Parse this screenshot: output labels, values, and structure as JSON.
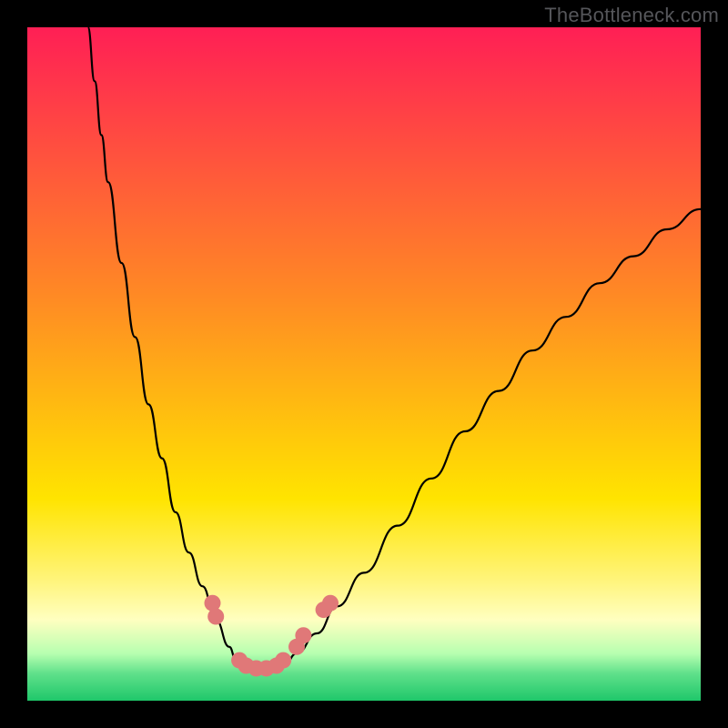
{
  "watermark": "TheBottleneck.com",
  "chart_data": {
    "type": "line",
    "title": "",
    "xlabel": "",
    "ylabel": "",
    "xlim": [
      0,
      100
    ],
    "ylim": [
      0,
      100
    ],
    "grid": false,
    "legend": false,
    "gradient_stops": [
      {
        "offset": 0.0,
        "color": "#ff1f55"
      },
      {
        "offset": 0.4,
        "color": "#ff8a24"
      },
      {
        "offset": 0.7,
        "color": "#ffe400"
      },
      {
        "offset": 0.82,
        "color": "#fff47a"
      },
      {
        "offset": 0.88,
        "color": "#ffffc0"
      },
      {
        "offset": 0.93,
        "color": "#b7ffb0"
      },
      {
        "offset": 0.96,
        "color": "#5fe08a"
      },
      {
        "offset": 1.0,
        "color": "#1fc76a"
      }
    ],
    "series": [
      {
        "name": "left-branch",
        "color": "#000000",
        "x": [
          9,
          10,
          11,
          12,
          14,
          16,
          18,
          20,
          22,
          24,
          26,
          28,
          30,
          31,
          32
        ],
        "values": [
          100,
          92,
          84,
          77,
          65,
          54,
          44,
          36,
          28,
          22,
          17,
          12,
          8,
          6,
          5
        ]
      },
      {
        "name": "right-branch",
        "color": "#000000",
        "x": [
          38,
          40,
          43,
          46,
          50,
          55,
          60,
          65,
          70,
          75,
          80,
          85,
          90,
          95,
          100
        ],
        "values": [
          5,
          7,
          10,
          14,
          19,
          26,
          33,
          40,
          46,
          52,
          57,
          62,
          66,
          70,
          73
        ]
      }
    ],
    "marker_points": [
      {
        "x": 27.5,
        "y": 14.5
      },
      {
        "x": 28.0,
        "y": 12.5
      },
      {
        "x": 31.5,
        "y": 6.0
      },
      {
        "x": 32.5,
        "y": 5.2
      },
      {
        "x": 34.0,
        "y": 4.8
      },
      {
        "x": 35.5,
        "y": 4.8
      },
      {
        "x": 37.0,
        "y": 5.2
      },
      {
        "x": 38.0,
        "y": 6.0
      },
      {
        "x": 40.0,
        "y": 8.0
      },
      {
        "x": 41.0,
        "y": 9.7
      },
      {
        "x": 44.0,
        "y": 13.5
      },
      {
        "x": 45.0,
        "y": 14.5
      }
    ],
    "marker_style": {
      "color": "#e07878",
      "radius_px": 9
    }
  }
}
